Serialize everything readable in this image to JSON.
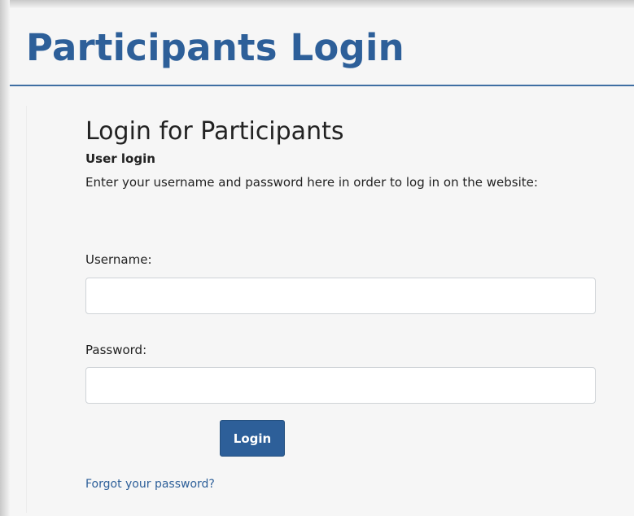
{
  "page": {
    "title": "Participants Login",
    "accent_color": "#2d5f99"
  },
  "login_form": {
    "heading": "Login for Participants",
    "block_label": "User login",
    "intro": "Enter your username and password here in order to log in on the website:",
    "username": {
      "label": "Username:",
      "value": "",
      "placeholder": ""
    },
    "password": {
      "label": "Password:",
      "value": "",
      "placeholder": ""
    },
    "submit_label": "Login",
    "forgot_link": "Forgot your password?"
  }
}
